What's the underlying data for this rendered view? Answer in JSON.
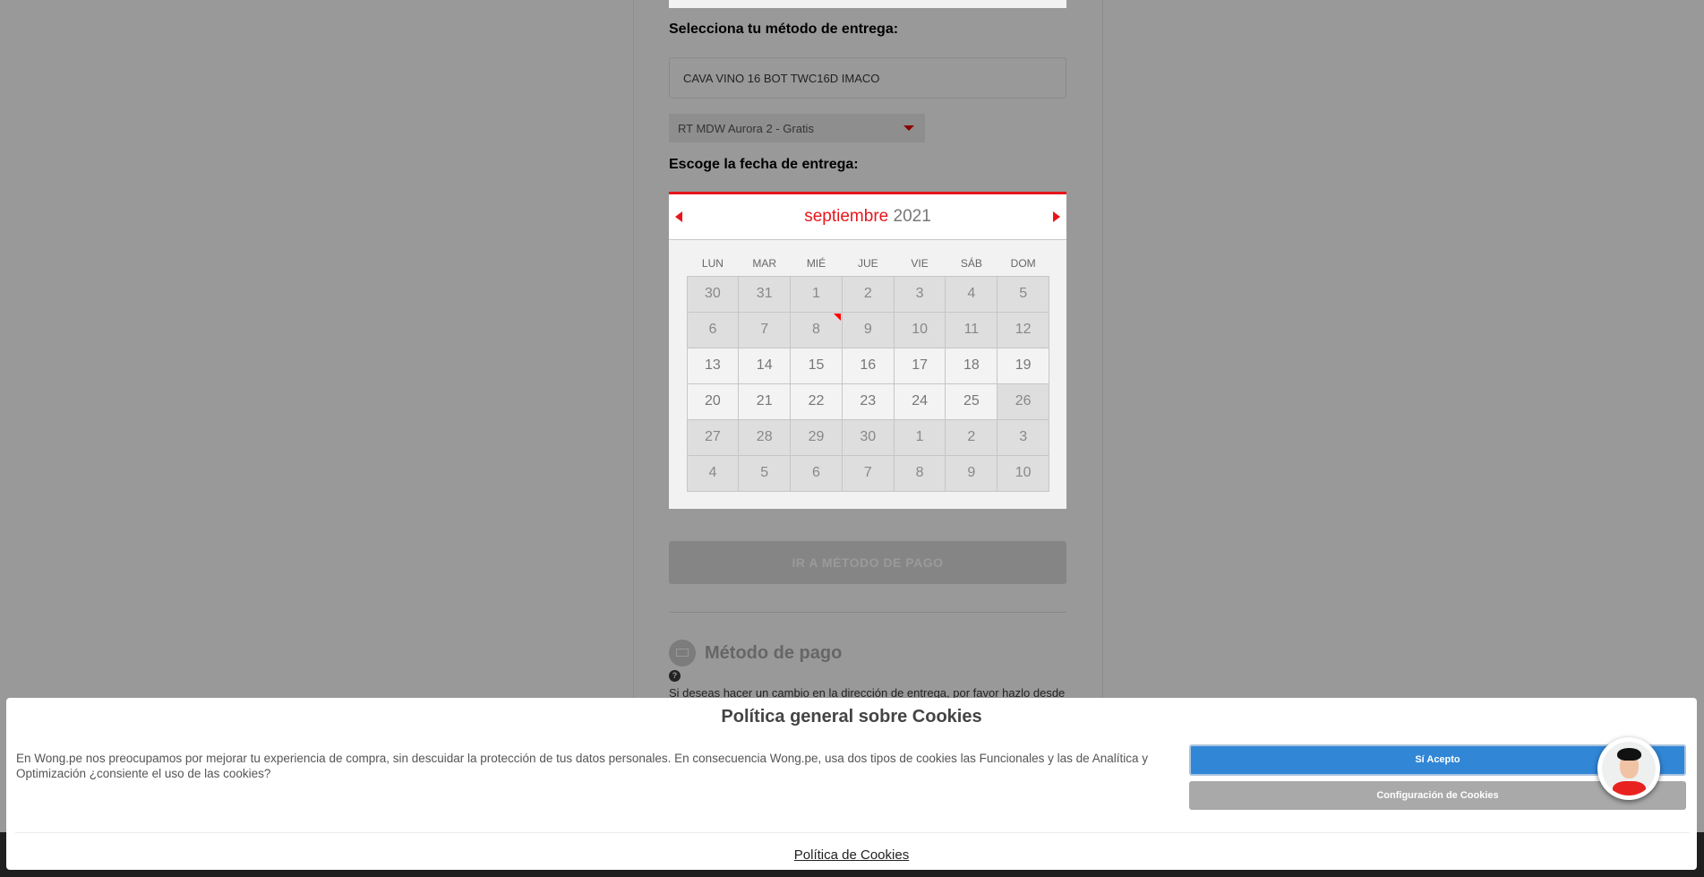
{
  "delivery": {
    "method_label": "Selecciona tu método de entrega:",
    "product": "CAVA VINO 16 BOT TWC16D IMACO",
    "store_select": "RT MDW Aurora 2 - Gratis",
    "date_label": "Escoge la fecha de entrega:"
  },
  "calendar": {
    "month": "septiembre",
    "year": "2021",
    "weekdays": [
      "LUN",
      "MAR",
      "MIÉ",
      "JUE",
      "VIE",
      "SÁB",
      "DOM"
    ],
    "days": [
      {
        "d": "30",
        "on": false
      },
      {
        "d": "31",
        "on": false
      },
      {
        "d": "1",
        "on": false
      },
      {
        "d": "2",
        "on": false
      },
      {
        "d": "3",
        "on": false
      },
      {
        "d": "4",
        "on": false
      },
      {
        "d": "5",
        "on": false
      },
      {
        "d": "6",
        "on": false
      },
      {
        "d": "7",
        "on": false
      },
      {
        "d": "8",
        "on": false,
        "today": true
      },
      {
        "d": "9",
        "on": false
      },
      {
        "d": "10",
        "on": false
      },
      {
        "d": "11",
        "on": false
      },
      {
        "d": "12",
        "on": false
      },
      {
        "d": "13",
        "on": true
      },
      {
        "d": "14",
        "on": true
      },
      {
        "d": "15",
        "on": true
      },
      {
        "d": "16",
        "on": true
      },
      {
        "d": "17",
        "on": true
      },
      {
        "d": "18",
        "on": true
      },
      {
        "d": "19",
        "on": true
      },
      {
        "d": "20",
        "on": true
      },
      {
        "d": "21",
        "on": true
      },
      {
        "d": "22",
        "on": true
      },
      {
        "d": "23",
        "on": true
      },
      {
        "d": "24",
        "on": true
      },
      {
        "d": "25",
        "on": true
      },
      {
        "d": "26",
        "on": false
      },
      {
        "d": "27",
        "on": false
      },
      {
        "d": "28",
        "on": false
      },
      {
        "d": "29",
        "on": false
      },
      {
        "d": "30",
        "on": false
      },
      {
        "d": "1",
        "on": false
      },
      {
        "d": "2",
        "on": false
      },
      {
        "d": "3",
        "on": false
      },
      {
        "d": "4",
        "on": false
      },
      {
        "d": "5",
        "on": false
      },
      {
        "d": "6",
        "on": false
      },
      {
        "d": "7",
        "on": false
      },
      {
        "d": "8",
        "on": false
      },
      {
        "d": "9",
        "on": false
      },
      {
        "d": "10",
        "on": false
      }
    ],
    "accent_color": "#e8161b"
  },
  "go_payment_button": "IR A MÉTODO DE PAGO",
  "payment": {
    "title": "Método de pago",
    "help_icon": "?",
    "text": "Si deseas hacer un cambio en la dirección de entrega, por favor hazlo desde"
  },
  "cookies": {
    "title": "Política general sobre Cookies",
    "text": "En Wong.pe nos preocupamos por mejorar tu experiencia de compra, sin descuidar la protección de tus datos personales. En consecuencia Wong.pe, usa dos tipos de cookies las Funcionales y las de Analítica y Optimización ¿consiente el uso de las cookies?",
    "accept": "Sí Acepto",
    "config": "Configuración de Cookies",
    "link": "Política de Cookies",
    "accept_color": "#3186d6"
  }
}
